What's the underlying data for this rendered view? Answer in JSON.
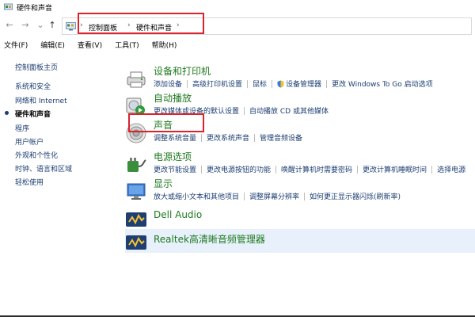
{
  "window": {
    "title": "硬件和声音"
  },
  "address": {
    "crumbs": [
      "控制面板",
      "硬件和声音"
    ],
    "separator": "›"
  },
  "nav": {
    "back": "←",
    "forward": "→",
    "down": "⌄",
    "up": "↑"
  },
  "menubar": {
    "items": [
      "文件(F)",
      "编辑(E)",
      "查看(V)",
      "工具(T)",
      "帮助(H)"
    ]
  },
  "sidebar": {
    "items": [
      {
        "label": "控制面板主页",
        "current": false
      },
      {
        "label": "系统和安全",
        "current": false
      },
      {
        "label": "网络和 Internet",
        "current": false
      },
      {
        "label": "硬件和声音",
        "current": true
      },
      {
        "label": "程序",
        "current": false
      },
      {
        "label": "用户帐户",
        "current": false
      },
      {
        "label": "外观和个性化",
        "current": false
      },
      {
        "label": "时钟、语言和区域",
        "current": false
      },
      {
        "label": "轻松使用",
        "current": false
      }
    ]
  },
  "categories": [
    {
      "title": "设备和打印机",
      "icon": "printer-icon",
      "links": [
        "添加设备",
        "高级打印机设置",
        "鼠标",
        "设备管理器",
        "更改 Windows To Go 启动选项"
      ]
    },
    {
      "title": "自动播放",
      "icon": "autoplay-icon",
      "links": [
        "更改媒体或设备的默认设置",
        "自动播放 CD 或其他媒体"
      ]
    },
    {
      "title": "声音",
      "icon": "speaker-icon",
      "links": [
        "调整系统音量",
        "更改系统声音",
        "管理音频设备"
      ]
    },
    {
      "title": "电源选项",
      "icon": "power-icon",
      "links": [
        "更改节能设置",
        "更改电源按钮的功能",
        "唤醒计算机时需要密码",
        "更改计算机睡眠时间",
        "选择电源"
      ]
    },
    {
      "title": "显示",
      "icon": "display-icon",
      "links": [
        "放大或缩小文本和其他项目",
        "调整屏幕分辨率",
        "如何更正显示器闪烁(刷新率)"
      ]
    },
    {
      "title": "Dell Audio",
      "icon": "dell-audio-icon",
      "links": []
    },
    {
      "title": "Realtek高清晰音频管理器",
      "icon": "realtek-audio-icon",
      "links": []
    }
  ],
  "colors": {
    "category_title": "#1e7a1e",
    "link": "#1c3d73",
    "highlight": "#e7f0fb",
    "annotation_box": "#d9232d"
  }
}
